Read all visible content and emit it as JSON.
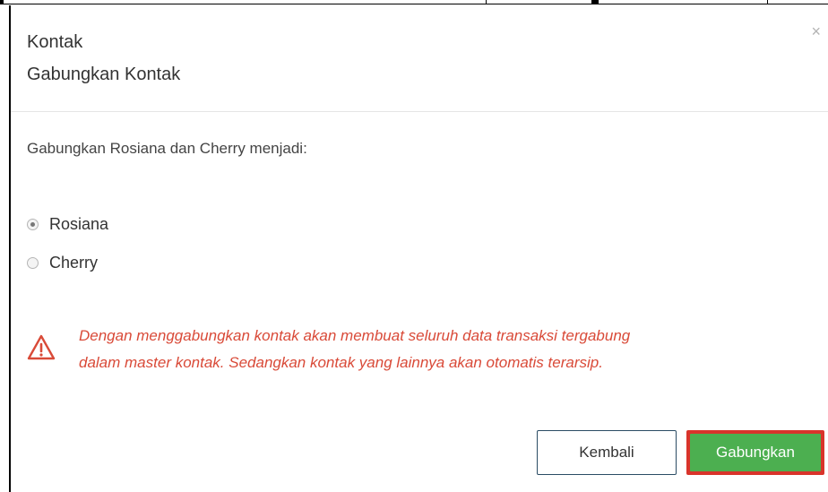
{
  "dialog": {
    "breadcrumb": "Kontak",
    "title": "Gabungkan Kontak",
    "close_symbol": "×"
  },
  "question": "Gabungkan Rosiana dan Cherry menjadi:",
  "options": [
    {
      "label": "Rosiana",
      "selected": true
    },
    {
      "label": "Cherry",
      "selected": false
    }
  ],
  "warning": {
    "icon": "warning-triangle-icon",
    "line1": "Dengan menggabungkan kontak akan membuat seluruh data transaksi tergabung",
    "line2": "dalam master kontak. Sedangkan kontak yang lainnya akan otomatis terarsip.",
    "color": "#d94a38"
  },
  "buttons": {
    "back_label": "Kembali",
    "merge_label": "Gabungkan",
    "merge_color": "#4caf50",
    "highlight_color": "#d9342b"
  }
}
